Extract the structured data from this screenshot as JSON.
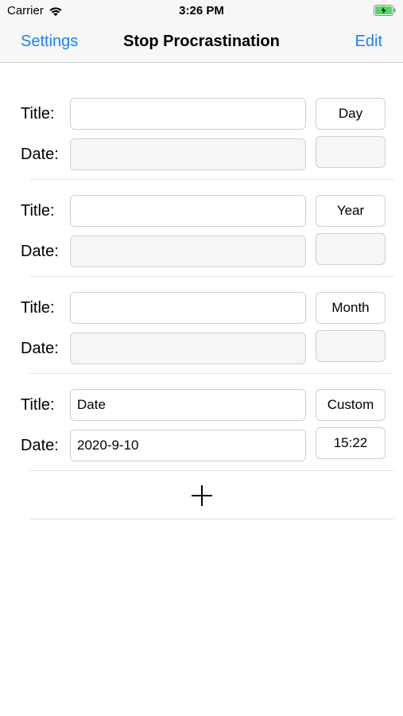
{
  "status_bar": {
    "carrier": "Carrier",
    "time": "3:26 PM",
    "wifi_icon": "wifi-icon",
    "battery_icon": "battery-charging-icon"
  },
  "nav": {
    "left_label": "Settings",
    "title": "Stop Procrastination",
    "right_label": "Edit",
    "accent_color": "#1a82f7"
  },
  "labels": {
    "title": "Title:",
    "date": "Date:"
  },
  "groups": [
    {
      "title_value": "",
      "date_value": "",
      "period_label": "Day",
      "time_value": ""
    },
    {
      "title_value": "",
      "date_value": "",
      "period_label": "Year",
      "time_value": ""
    },
    {
      "title_value": "",
      "date_value": "",
      "period_label": "Month",
      "time_value": ""
    },
    {
      "title_value": "Date",
      "date_value": "2020-9-10",
      "period_label": "Custom",
      "time_value": "15:22"
    }
  ],
  "add_icon": "plus-icon"
}
